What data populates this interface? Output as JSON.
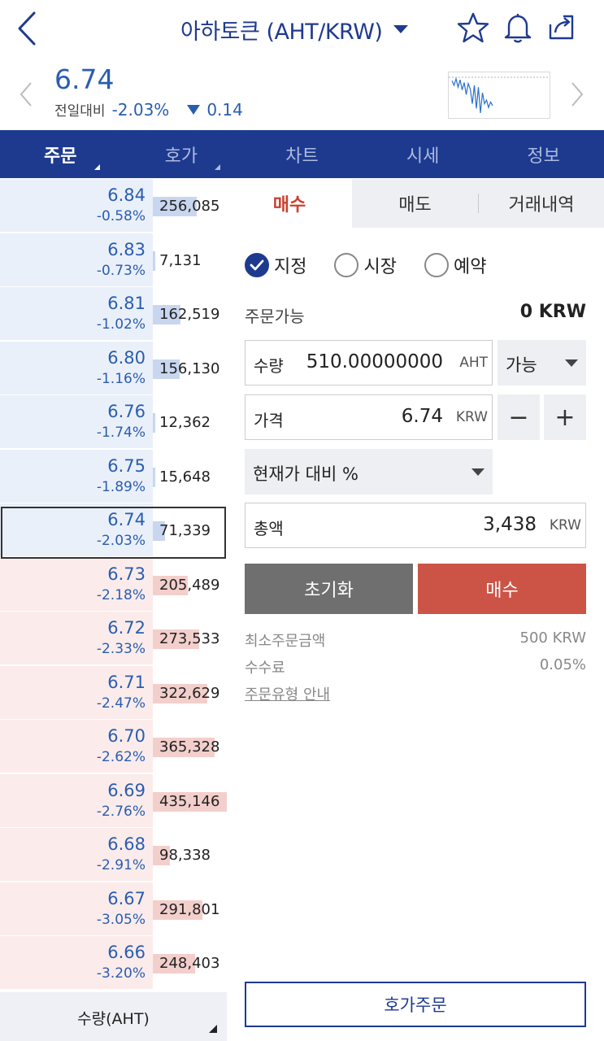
{
  "header": {
    "title": "아하토큰 (AHT/KRW)",
    "icons": [
      "back-icon",
      "star-icon",
      "bell-icon",
      "share-icon"
    ]
  },
  "ticker": {
    "price": "6.74",
    "change_label": "전일대비",
    "change_pct": "-2.03%",
    "change_abs": "0.14",
    "mini_chart_values": [
      6.95,
      6.9,
      6.97,
      6.88,
      6.96,
      6.85,
      6.93,
      6.8,
      6.92,
      6.86,
      6.7,
      6.9,
      6.65,
      6.88,
      6.6,
      6.82,
      6.7,
      6.74,
      6.66,
      6.72,
      6.68
    ]
  },
  "main_tabs": [
    {
      "label": "주문",
      "active": true
    },
    {
      "label": "호가",
      "active": false
    },
    {
      "label": "차트",
      "active": false
    },
    {
      "label": "시세",
      "active": false
    },
    {
      "label": "정보",
      "active": false
    }
  ],
  "orderbook": {
    "max_qty": 435146,
    "rows": [
      {
        "side": "ask",
        "price": "6.84",
        "pct": "-0.58%",
        "qty": "256,085",
        "qty_num": 256085
      },
      {
        "side": "ask",
        "price": "6.83",
        "pct": "-0.73%",
        "qty": "7,131",
        "qty_num": 7131
      },
      {
        "side": "ask",
        "price": "6.81",
        "pct": "-1.02%",
        "qty": "162,519",
        "qty_num": 162519
      },
      {
        "side": "ask",
        "price": "6.80",
        "pct": "-1.16%",
        "qty": "156,130",
        "qty_num": 156130
      },
      {
        "side": "ask",
        "price": "6.76",
        "pct": "-1.74%",
        "qty": "12,362",
        "qty_num": 12362
      },
      {
        "side": "ask",
        "price": "6.75",
        "pct": "-1.89%",
        "qty": "15,648",
        "qty_num": 15648
      },
      {
        "side": "ask",
        "price": "6.74",
        "pct": "-2.03%",
        "qty": "71,339",
        "qty_num": 71339
      },
      {
        "side": "bid",
        "price": "6.73",
        "pct": "-2.18%",
        "qty": "205,489",
        "qty_num": 205489
      },
      {
        "side": "bid",
        "price": "6.72",
        "pct": "-2.33%",
        "qty": "273,533",
        "qty_num": 273533
      },
      {
        "side": "bid",
        "price": "6.71",
        "pct": "-2.47%",
        "qty": "322,629",
        "qty_num": 322629
      },
      {
        "side": "bid",
        "price": "6.70",
        "pct": "-2.62%",
        "qty": "365,328",
        "qty_num": 365328
      },
      {
        "side": "bid",
        "price": "6.69",
        "pct": "-2.76%",
        "qty": "435,146",
        "qty_num": 435146
      },
      {
        "side": "bid",
        "price": "6.68",
        "pct": "-2.91%",
        "qty": "98,338",
        "qty_num": 98338
      },
      {
        "side": "bid",
        "price": "6.67",
        "pct": "-3.05%",
        "qty": "291,801",
        "qty_num": 291801
      },
      {
        "side": "bid",
        "price": "6.66",
        "pct": "-3.20%",
        "qty": "248,403",
        "qty_num": 248403
      }
    ],
    "footer_label": "수량(AHT)"
  },
  "order": {
    "sub_tabs": [
      {
        "label": "매수",
        "active": true
      },
      {
        "label": "매도",
        "active": false
      },
      {
        "label": "거래내역",
        "active": false
      }
    ],
    "order_types": [
      {
        "label": "지정",
        "checked": true
      },
      {
        "label": "시장",
        "checked": false
      },
      {
        "label": "예약",
        "checked": false
      }
    ],
    "available_label": "주문가능",
    "available_value": "0 KRW",
    "quantity": {
      "label": "수량",
      "value": "510.00000000",
      "unit": "AHT",
      "select": "가능"
    },
    "price": {
      "label": "가격",
      "value": "6.74",
      "unit": "KRW",
      "minus": "−",
      "plus": "+"
    },
    "percent_select": "현재가 대비 %",
    "total": {
      "label": "총액",
      "value": "3,438",
      "unit": "KRW"
    },
    "reset_label": "초기화",
    "buy_label": "매수",
    "min_order_label": "최소주문금액",
    "min_order_value": "500 KRW",
    "fee_label": "수수료",
    "fee_value": "0.05%",
    "guide_link": "주문유형 안내",
    "quote_order_label": "호가주문"
  },
  "colors": {
    "brand": "#1d3a8f",
    "down": "#2a5db0",
    "buy": "#cc5446",
    "ask_bg": "#eaf0fa",
    "bid_bg": "#fbeceb"
  }
}
